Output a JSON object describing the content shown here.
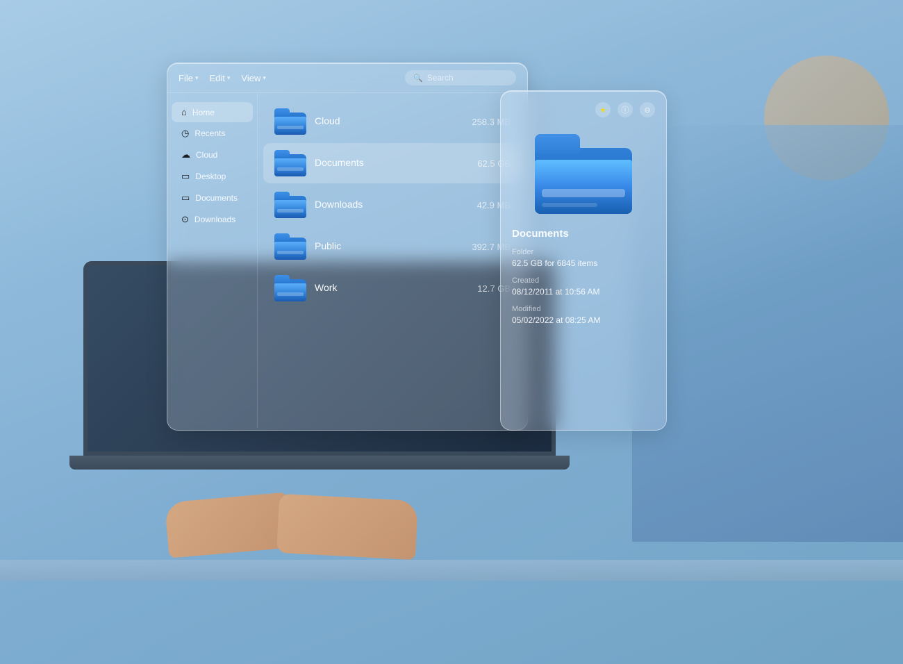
{
  "background": {
    "color": "#a8c8e8"
  },
  "toolbar": {
    "file_label": "File",
    "edit_label": "Edit",
    "view_label": "View",
    "search_placeholder": "Search"
  },
  "sidebar": {
    "items": [
      {
        "id": "home",
        "label": "Home",
        "icon": "🏠",
        "active": true
      },
      {
        "id": "recents",
        "label": "Recents",
        "icon": "🕐",
        "active": false
      },
      {
        "id": "cloud",
        "label": "Cloud",
        "icon": "☁",
        "active": false
      },
      {
        "id": "desktop",
        "label": "Desktop",
        "icon": "🖥",
        "active": false
      },
      {
        "id": "documents",
        "label": "Documents",
        "icon": "📄",
        "active": false
      },
      {
        "id": "downloads",
        "label": "Downloads",
        "icon": "⬇",
        "active": false
      }
    ]
  },
  "file_list": {
    "items": [
      {
        "name": "Cloud",
        "size": "258.3 MB",
        "selected": false
      },
      {
        "name": "Documents",
        "size": "62.5 GB",
        "selected": true
      },
      {
        "name": "Downloads",
        "size": "42.9 MB",
        "selected": false
      },
      {
        "name": "Public",
        "size": "392.7 MB",
        "selected": false
      },
      {
        "name": "Work",
        "size": "12.7 GB",
        "selected": false
      }
    ]
  },
  "info_panel": {
    "title": "Documents",
    "type_label": "Folder",
    "type_value": "Folder",
    "size_label": "62.5 GB for 6845 items",
    "created_label": "Created",
    "created_value": "08/12/2011 at 10:56 AM",
    "modified_label": "Modified",
    "modified_value": "05/02/2022 at 08:25 AM"
  }
}
